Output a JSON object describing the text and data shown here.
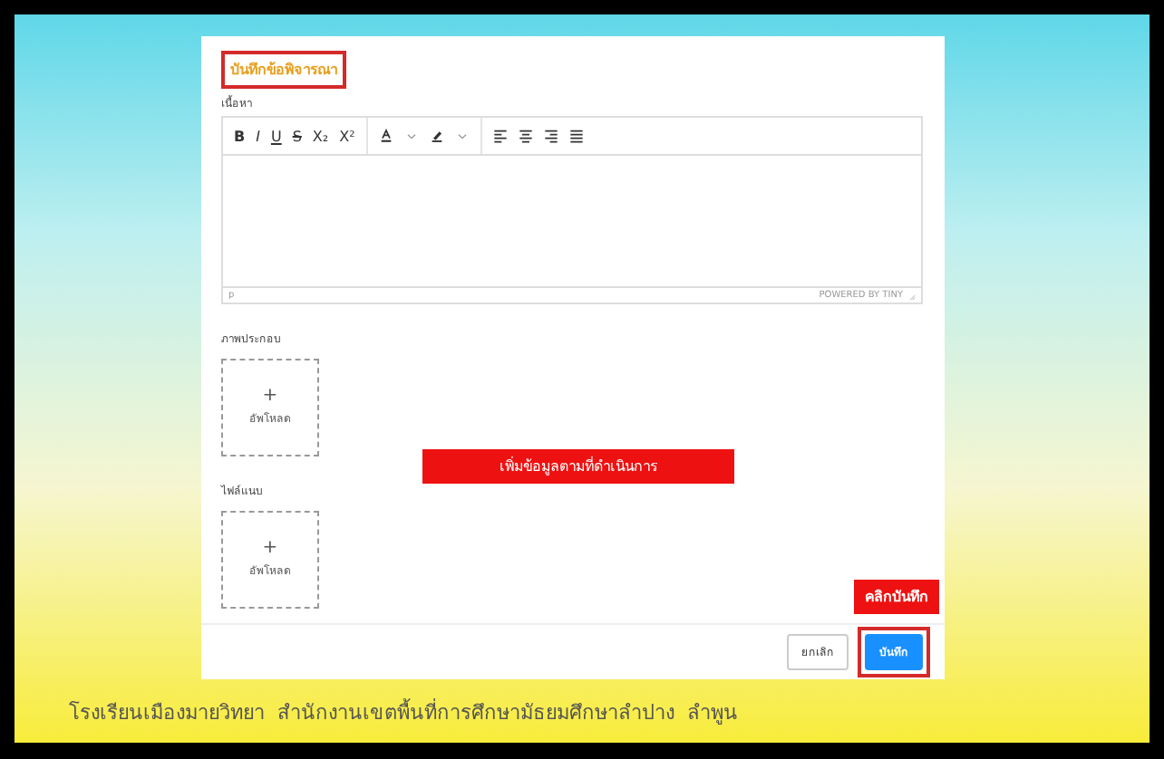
{
  "form": {
    "title": "บันทึกข้อพิจารณา",
    "content_label": "เนื้อหา",
    "toolbar": [
      [
        {
          "kind": "bold",
          "label": "B"
        },
        {
          "kind": "italic",
          "label": "I"
        },
        {
          "kind": "underline",
          "label": "U"
        },
        {
          "kind": "strike",
          "label": "S"
        },
        {
          "kind": "subscript",
          "label": "X₂"
        },
        {
          "kind": "superscript",
          "label": "X²"
        }
      ],
      [
        {
          "kind": "text-color"
        },
        {
          "kind": "highlight"
        }
      ],
      [
        {
          "kind": "align-left"
        },
        {
          "kind": "align-center"
        },
        {
          "kind": "align-right"
        },
        {
          "kind": "justify"
        }
      ]
    ],
    "editor_path": "p",
    "powered_by": "POWERED BY TINY",
    "uploads": [
      {
        "label": "ภาพประกอบ",
        "plus": "+",
        "text": "อัพโหลด"
      },
      {
        "label": "ไฟล์แนบ",
        "plus": "+",
        "text": "อัพโหลด"
      }
    ],
    "buttons": [
      {
        "label": "ยกเลิก",
        "kind": "secondary"
      },
      {
        "label": "บันทึก",
        "kind": "primary"
      }
    ]
  },
  "annotations": [
    {
      "text": "เพิ่มข้อมูลตามที่ดำเนินการ",
      "kind": "center"
    },
    {
      "text": "คลิกบันทึก",
      "kind": "save"
    }
  ],
  "footer": {
    "text": "โรงเรียนเมืองมายวิทยา  สำนักงานเขตพื้นที่การศึกษามัธยมศึกษาลำปาง  ลำพูน"
  }
}
